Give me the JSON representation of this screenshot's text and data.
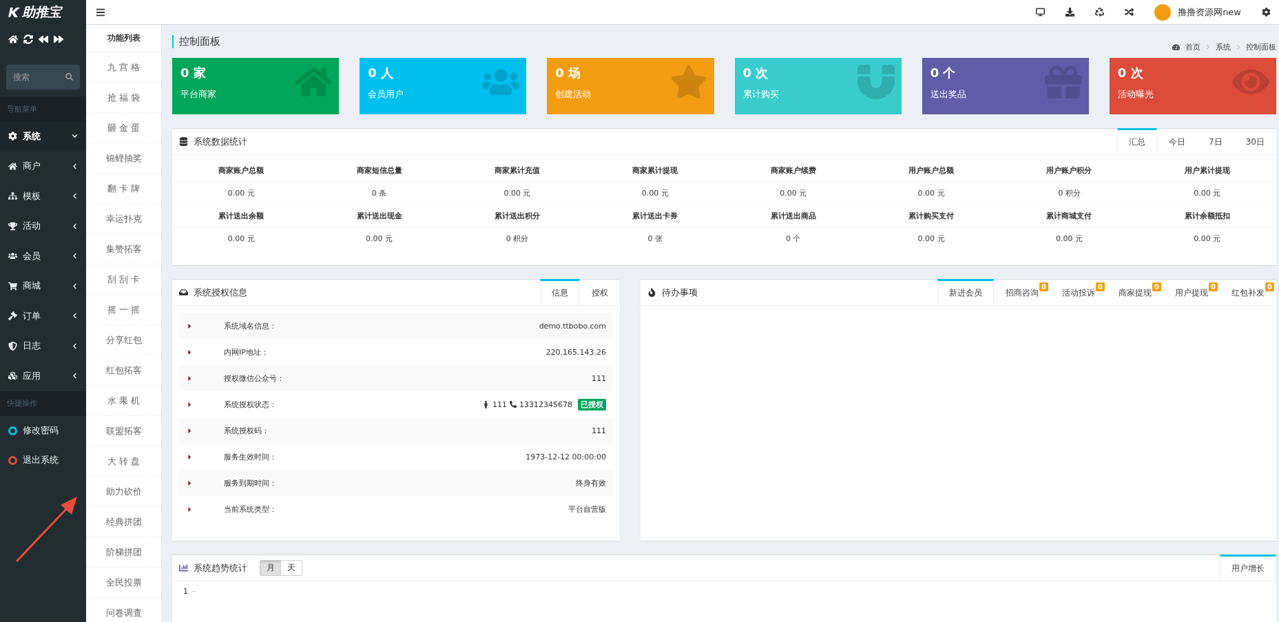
{
  "sidebar": {
    "logo": "助推宝",
    "search": {
      "placeholder": "搜索"
    },
    "nav_header": "导航菜单",
    "nav_items": [
      {
        "label": "系统",
        "expanded": true
      },
      {
        "label": "商户",
        "expanded": false
      },
      {
        "label": "模板",
        "expanded": false
      },
      {
        "label": "活动",
        "expanded": false
      },
      {
        "label": "会员",
        "expanded": false
      },
      {
        "label": "商城",
        "expanded": false
      },
      {
        "label": "订单",
        "expanded": false
      },
      {
        "label": "日志",
        "expanded": false
      },
      {
        "label": "应用",
        "expanded": false
      }
    ],
    "quick_header": "快捷操作",
    "quick_items": [
      {
        "label": "修改密码",
        "color": "#00c0ef"
      },
      {
        "label": "退出系统",
        "color": "#dd4b39"
      }
    ]
  },
  "topbar": {
    "user": "撸撸资源网new"
  },
  "function_list": {
    "title": "功能列表",
    "items": [
      "九 宫 格",
      "抢 福 袋",
      "砸 金 蛋",
      "锦鲤抽奖",
      "翻 卡 牌",
      "幸运扑克",
      "集赞拓客",
      "刮 刮 卡",
      "摇 一 摇",
      "分享红包",
      "红包拓客",
      "水 果 机",
      "联盟拓客",
      "大 转 盘",
      "助力砍价",
      "经典拼团",
      "阶梯拼团",
      "全民投票",
      "问卷调查"
    ]
  },
  "page_title": "控制面板",
  "breadcrumb": [
    "首页",
    "系统",
    "控制面板"
  ],
  "stat_cards": [
    {
      "value": "0 家",
      "label": "平台商家",
      "color": "#00a65a"
    },
    {
      "value": "0 人",
      "label": "会员用户",
      "color": "#00c0ef"
    },
    {
      "value": "0 场",
      "label": "创建活动",
      "color": "#f39c12"
    },
    {
      "value": "0 次",
      "label": "累计购买",
      "color": "#39cccc"
    },
    {
      "value": "0 个",
      "label": "送出奖品",
      "color": "#605ca8"
    },
    {
      "value": "0 次",
      "label": "活动曝光",
      "color": "#dd4b39"
    }
  ],
  "data_stats": {
    "title": "系统数据统计",
    "tabs": [
      {
        "label": "汇总",
        "selected": true
      },
      {
        "label": "今日",
        "selected": false
      },
      {
        "label": "7日",
        "selected": false
      },
      {
        "label": "30日",
        "selected": false
      }
    ],
    "rows": [
      [
        {
          "label": "商家账户总额",
          "value": "0.00 元"
        },
        {
          "label": "商家短信总量",
          "value": "0 条"
        },
        {
          "label": "商家累计充值",
          "value": "0.00 元"
        },
        {
          "label": "商家累计提现",
          "value": "0.00 元"
        },
        {
          "label": "商家账户续费",
          "value": "0.00 元"
        },
        {
          "label": "用户账户总额",
          "value": "0.00 元"
        },
        {
          "label": "用户账户积分",
          "value": "0 积分"
        },
        {
          "label": "用户累计提现",
          "value": "0.00 元"
        }
      ],
      [
        {
          "label": "累计送出余额",
          "value": "0.00 元"
        },
        {
          "label": "累计送出现金",
          "value": "0.00 元"
        },
        {
          "label": "累计送出积分",
          "value": "0 积分"
        },
        {
          "label": "累计送出卡券",
          "value": "0 张"
        },
        {
          "label": "累计送出商品",
          "value": "0 个"
        },
        {
          "label": "累计购买支付",
          "value": "0.00 元"
        },
        {
          "label": "累计商城支付",
          "value": "0.00 元"
        },
        {
          "label": "累计余额抵扣",
          "value": "0.00 元"
        }
      ]
    ]
  },
  "license_info": {
    "title": "系统授权信息",
    "tabs": [
      {
        "label": "信息",
        "selected": true
      },
      {
        "label": "授权",
        "selected": false
      }
    ],
    "rows": [
      {
        "kind": "text",
        "label": "系统域名信息：",
        "value": "demo.ttbobo.com"
      },
      {
        "kind": "text",
        "label": "内网IP地址：",
        "value": "220.165.143.26"
      },
      {
        "kind": "text",
        "label": "授权微信公众号：",
        "value": "111"
      },
      {
        "kind": "contact",
        "label": "系统授权状态：",
        "name": "111",
        "phone": "13312345678",
        "badge": "已授权"
      },
      {
        "kind": "text",
        "label": "系统授权码：",
        "value": "111"
      },
      {
        "kind": "text",
        "label": "服务生效时间：",
        "value": "1973-12-12 00:00:00"
      },
      {
        "kind": "text",
        "label": "服务到期时间：",
        "value": "终身有效"
      },
      {
        "kind": "text",
        "label": "当前系统类型：",
        "value": "平台自营版"
      }
    ]
  },
  "todo": {
    "title": "待办事项",
    "tabs": [
      {
        "label": "新进会员",
        "selected": true
      },
      {
        "label": "招商咨询",
        "selected": false,
        "count": "0"
      },
      {
        "label": "活动投诉",
        "selected": false,
        "count": "0"
      },
      {
        "label": "商家提现",
        "selected": false,
        "count": "0"
      },
      {
        "label": "用户提现",
        "selected": false,
        "count": "0"
      },
      {
        "label": "红包补发",
        "selected": false,
        "count": "0"
      }
    ]
  },
  "trend": {
    "title": "系统趋势统计",
    "toggle": [
      {
        "label": "月",
        "selected": true
      },
      {
        "label": "天",
        "selected": false
      }
    ],
    "tabs": [
      {
        "label": "用户增长",
        "selected": true
      }
    ],
    "axis_label": "1"
  }
}
